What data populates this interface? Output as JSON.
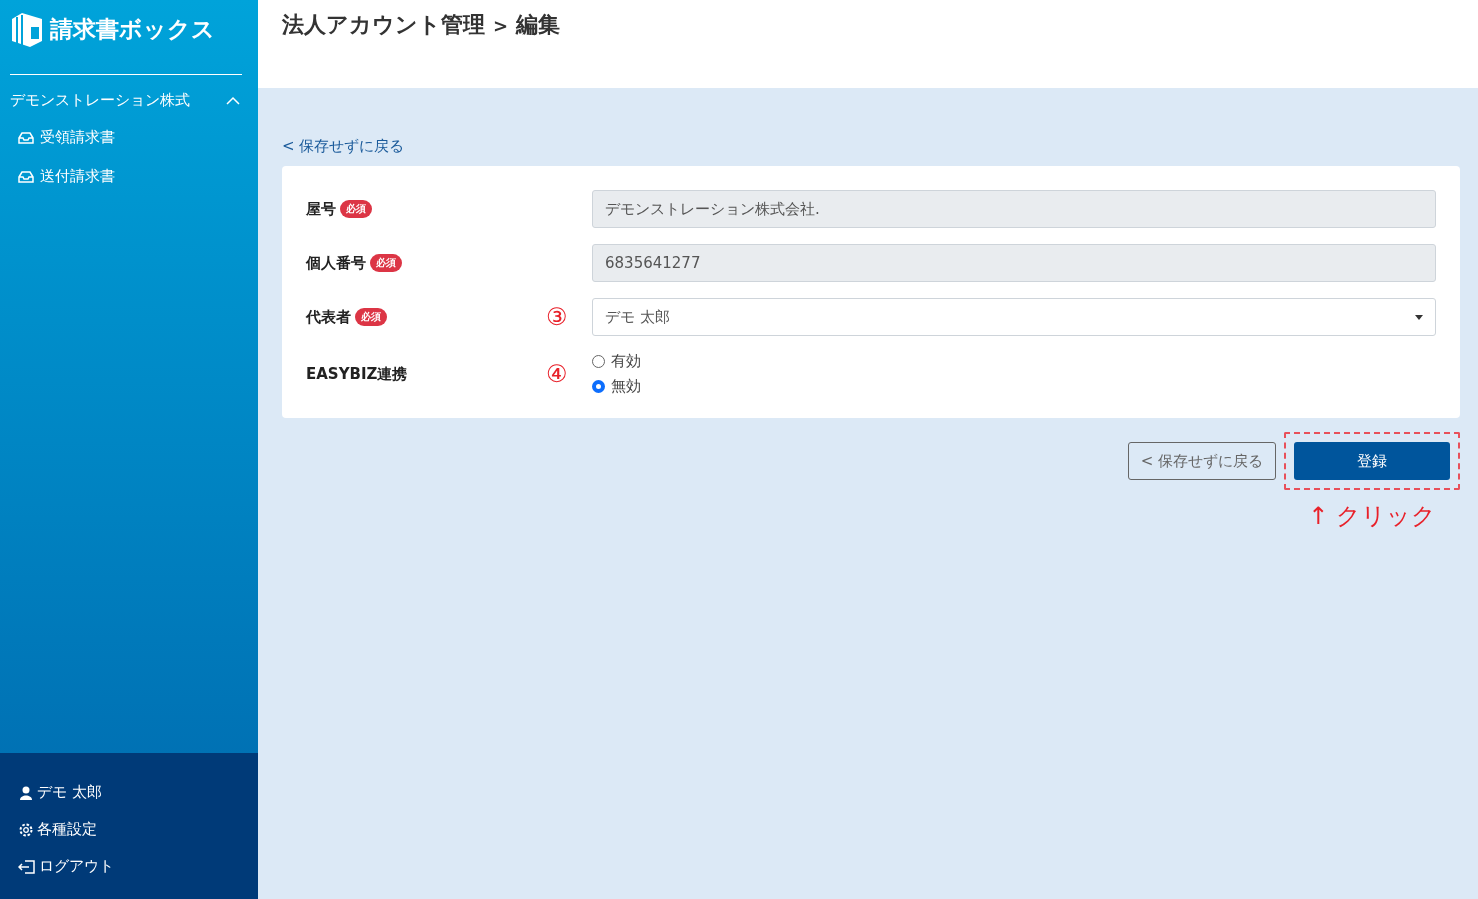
{
  "app": {
    "logo_text": "請求書ボックス"
  },
  "sidebar": {
    "company": {
      "label": "デモンストレーション株式",
      "expanded": true
    },
    "items": [
      {
        "label": "受領請求書"
      },
      {
        "label": "送付請求書"
      }
    ],
    "footer": [
      {
        "kind": "user",
        "label": "デモ 太郎"
      },
      {
        "kind": "settings",
        "label": "各種設定"
      },
      {
        "kind": "logout",
        "label": "ログアウト"
      }
    ]
  },
  "header": {
    "title": "法人アカウント管理",
    "separator": ">",
    "subtitle": "編集"
  },
  "back_link": "< 保存せずに戻る",
  "fields": [
    {
      "kind": "text",
      "label": "屋号",
      "required_badge": "必須",
      "value": "デモンストレーション株式会社.",
      "disabled": true
    },
    {
      "kind": "text",
      "label": "個人番号",
      "required_badge": "必須",
      "value": "6835641277",
      "disabled": true
    },
    {
      "kind": "select",
      "label": "代表者",
      "required_badge": "必須",
      "annotation": "③",
      "value": "デモ 太郎",
      "disabled": false
    },
    {
      "kind": "radio",
      "label": "EASYBIZ連携",
      "annotation": "④",
      "options": [
        {
          "label": "有効",
          "selected": false
        },
        {
          "label": "無効",
          "selected": true
        }
      ]
    }
  ],
  "actions": {
    "cancel": "< 保存せずに戻る",
    "submit": "登録",
    "callout": "↑ クリック"
  }
}
